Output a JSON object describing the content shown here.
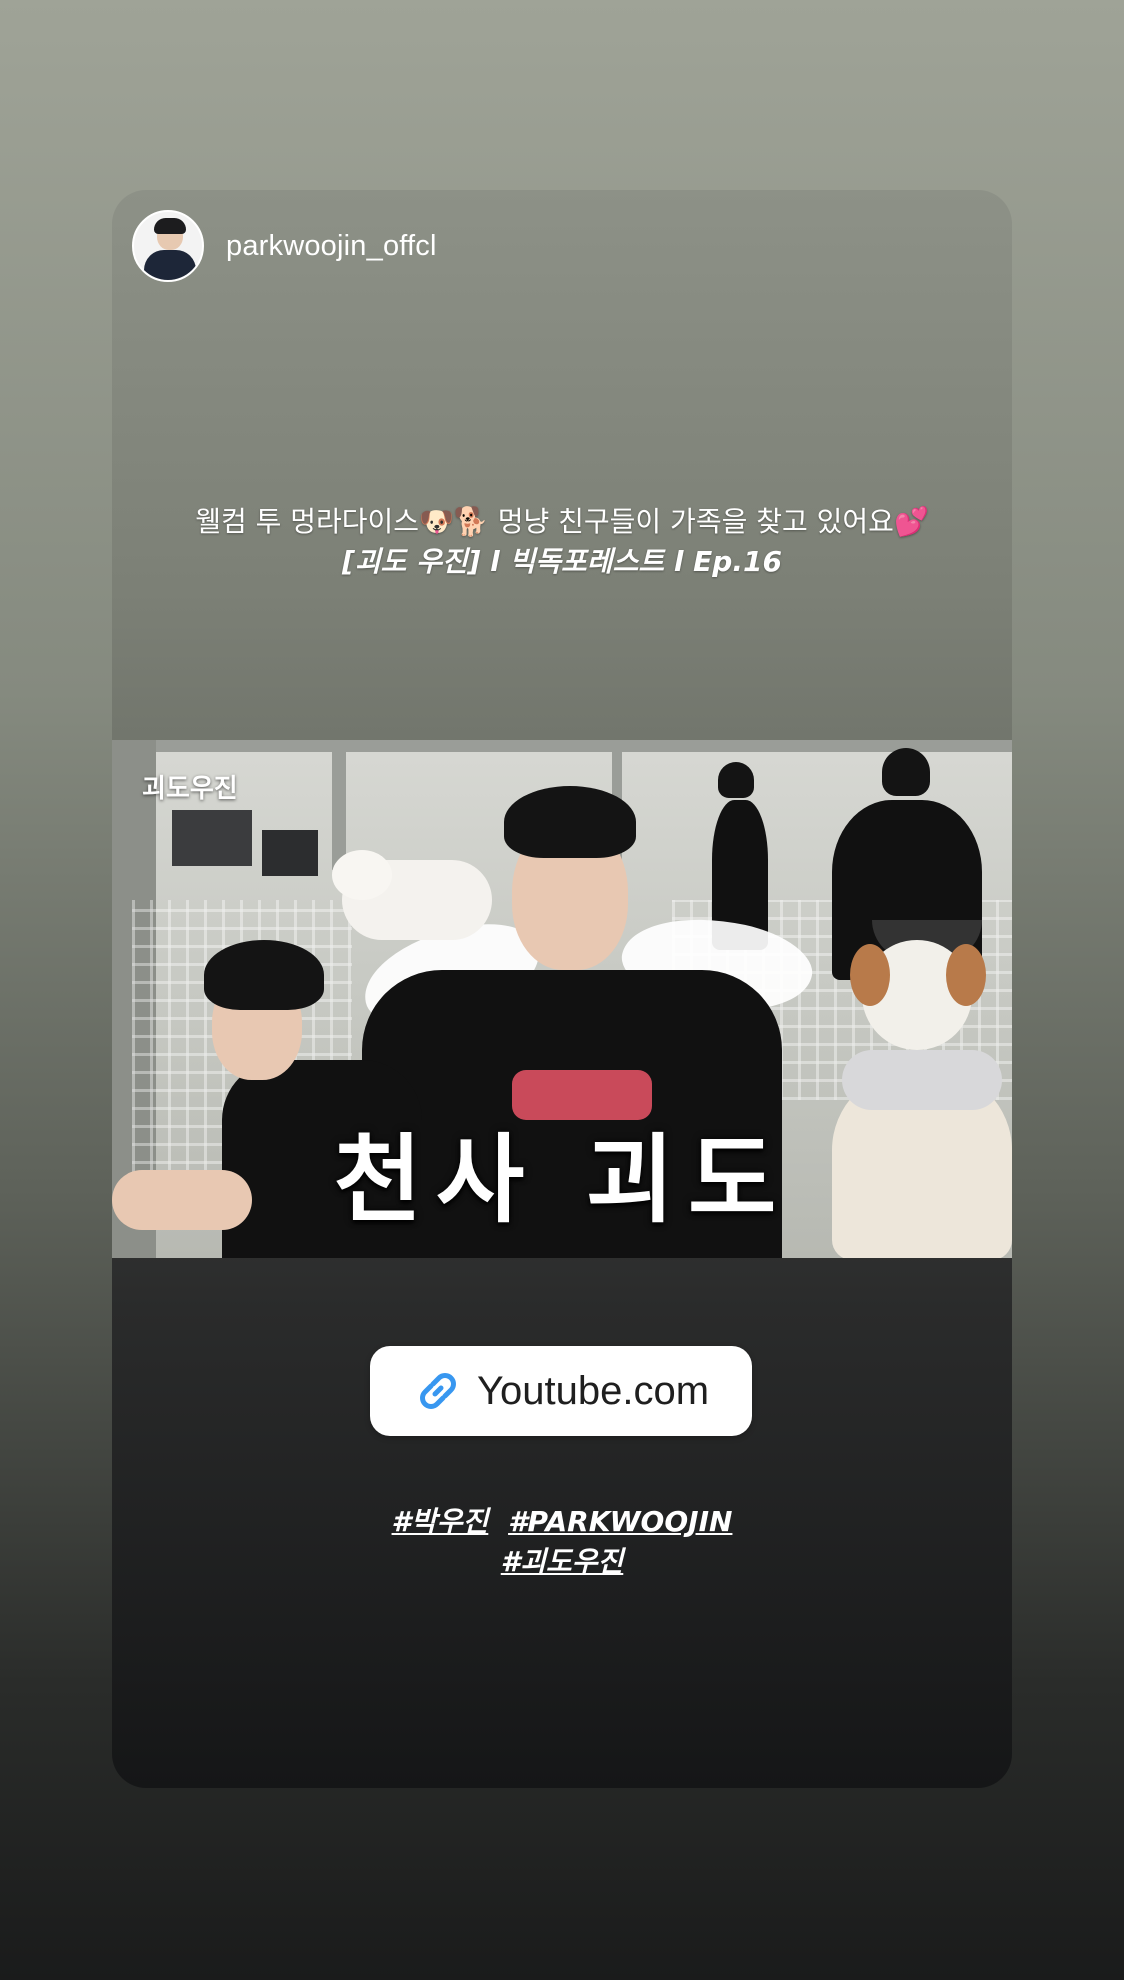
{
  "story": {
    "username": "parkwoojin_offcl",
    "caption_line1": "웰컴 투 멍라다이스🐶🐕 멍냥 친구들이 가족을 찾고 있어요💕",
    "caption_line2": "[괴도 우진] l 빅독포레스트 l Ep.16"
  },
  "thumbnail": {
    "logo_text": "괴도우진",
    "title_text": "천사 괴도"
  },
  "link_sticker": {
    "icon": "link-icon",
    "label": "Youtube.com",
    "icon_color": "#3897f0"
  },
  "hashtags": {
    "tag1": "#박우진",
    "tag2": "#PARKWOOJIN",
    "tag3": "#괴도우진"
  }
}
